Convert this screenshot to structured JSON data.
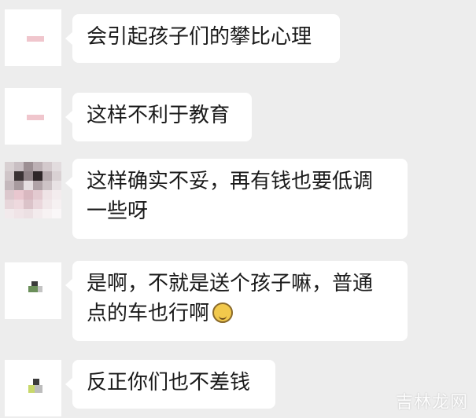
{
  "messages": [
    {
      "lines": [
        "会引起孩子们的攀比心理"
      ]
    },
    {
      "lines": [
        "这样不利于教育"
      ]
    },
    {
      "lines": [
        "这样确实不妥，再有钱也要低调",
        "一些呀"
      ]
    },
    {
      "lines": [
        "是啊，不就是送个孩子嘛，普通",
        "点的车也行啊"
      ],
      "emoji": "grin-emoji"
    },
    {
      "lines": [
        "反正你们也不差钱"
      ]
    }
  ],
  "watermark": "吉林龙网",
  "colors": {
    "background": "#ededed",
    "bubble": "#ffffff",
    "text": "#1a1a1a",
    "avatar_pink": "#f0c6cd"
  }
}
